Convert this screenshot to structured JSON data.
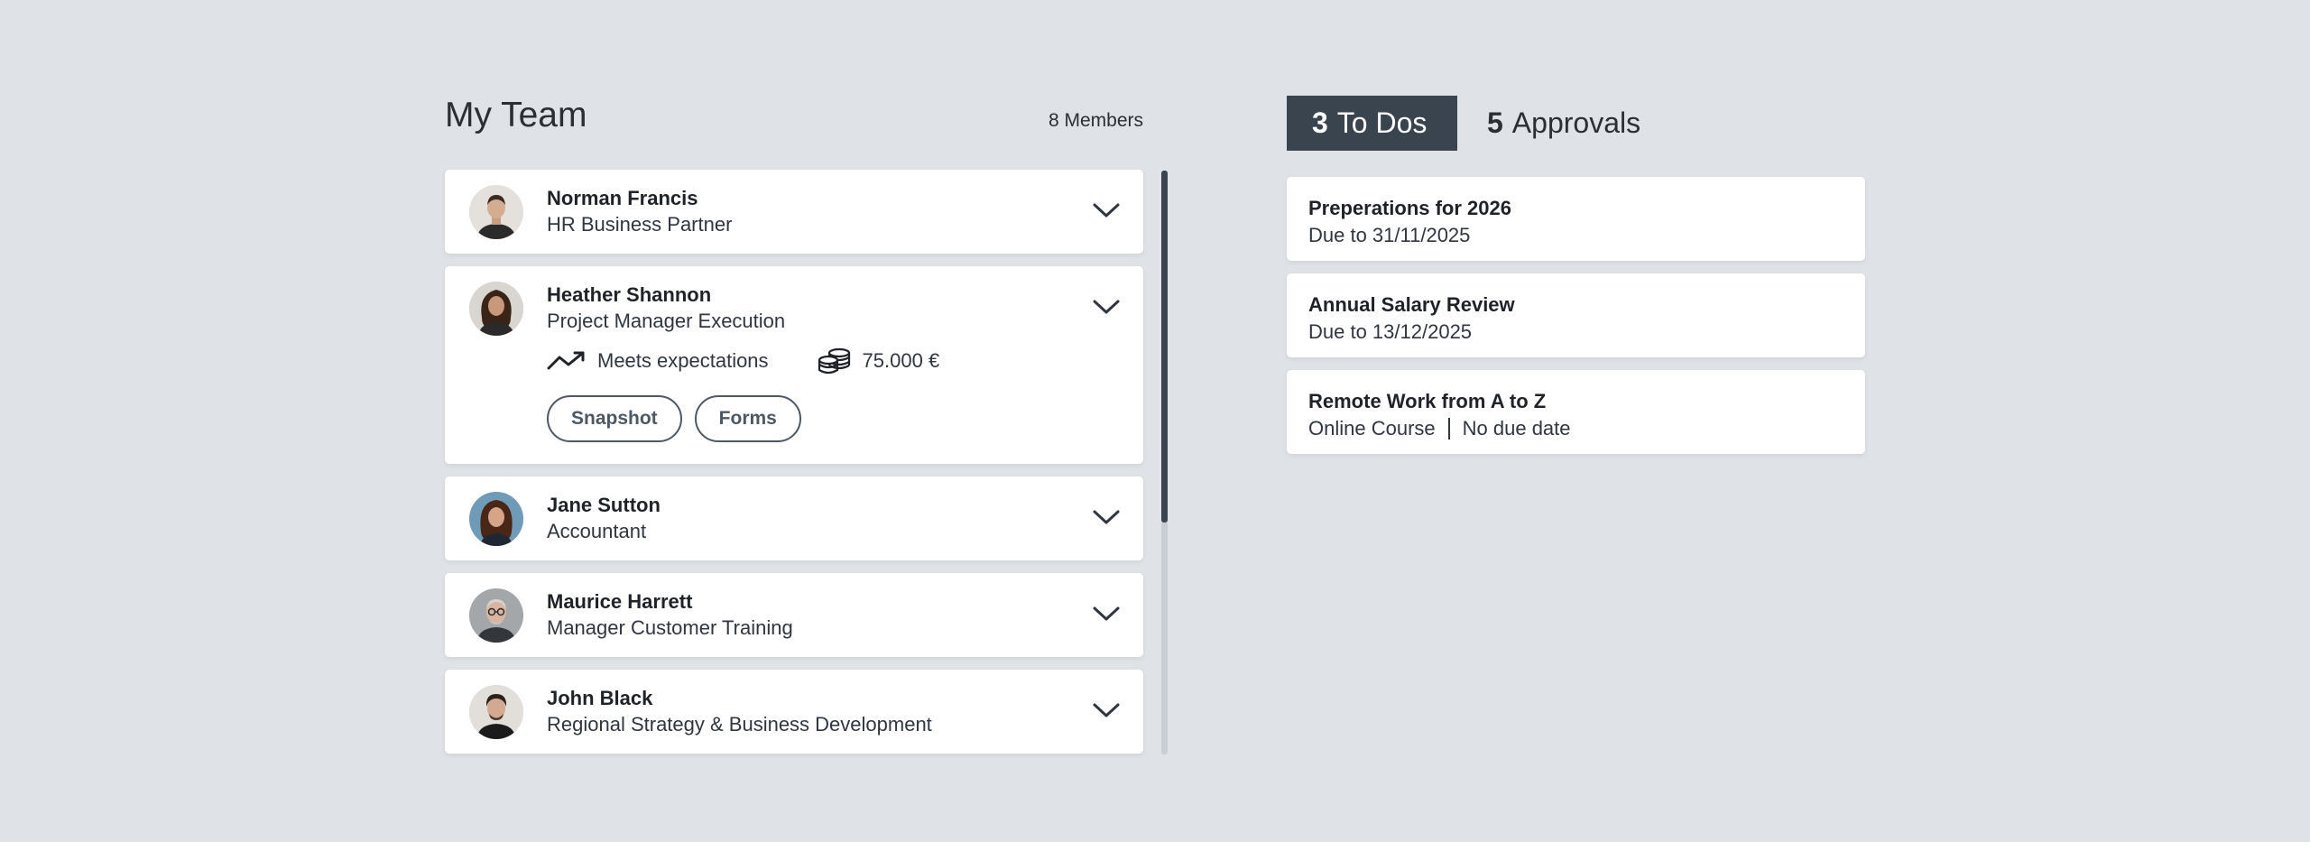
{
  "team": {
    "title": "My Team",
    "count_label": "8 Members",
    "members": [
      {
        "name": "Norman Francis",
        "role": "HR Business Partner"
      },
      {
        "name": "Heather Shannon",
        "role": "Project Manager Execution",
        "performance": "Meets expectations",
        "salary": "75.000 €",
        "actions": [
          "Snapshot",
          "Forms"
        ]
      },
      {
        "name": "Jane Sutton",
        "role": "Accountant"
      },
      {
        "name": "Maurice Harrett",
        "role": "Manager Customer Training"
      },
      {
        "name": "John Black",
        "role": "Regional Strategy & Business Development"
      }
    ]
  },
  "tabs": [
    {
      "count": "3",
      "label": "To Dos",
      "active": true
    },
    {
      "count": "5",
      "label": "Approvals",
      "active": false
    }
  ],
  "todos": [
    {
      "title": "Preperations for 2026",
      "due": "Due to 31/11/2025"
    },
    {
      "title": "Annual Salary Review",
      "due": "Due to 13/12/2025"
    },
    {
      "title": "Remote Work from A to Z",
      "type": "Online Course",
      "due": "No due date"
    }
  ],
  "colors": {
    "background": "#dfe3e7",
    "active_tab": "#3a444e",
    "pill_border": "#4d5865",
    "scroll_thumb": "#3c454f",
    "scroll_track": "#c9ced4"
  },
  "icons": [
    "chevron-down-icon",
    "trend-up-icon",
    "coins-icon"
  ]
}
